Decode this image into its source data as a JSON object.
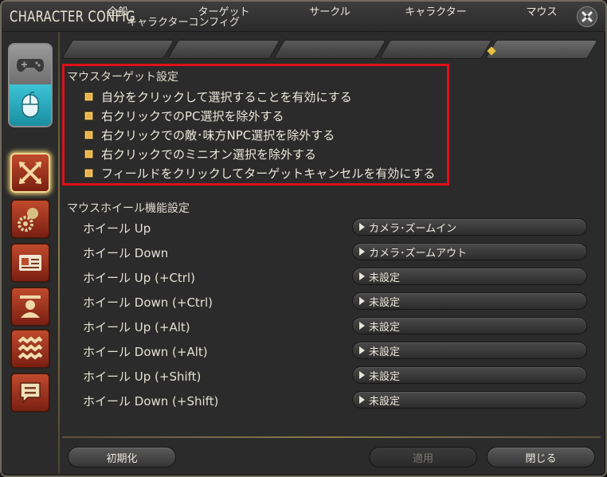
{
  "window": {
    "title": "CHARACTER CONFIG",
    "subtitle": "キャラクターコンフィグ"
  },
  "tabs": [
    {
      "label": "全般",
      "active": false
    },
    {
      "label": "ターゲット",
      "active": false
    },
    {
      "label": "サークル",
      "active": false
    },
    {
      "label": "キャラクター",
      "active": false
    },
    {
      "label": "マウス",
      "active": true
    }
  ],
  "mouse_target": {
    "title": "マウスターゲット設定",
    "options": [
      {
        "label": "自分をクリックして選択することを有効にする",
        "checked": true
      },
      {
        "label": "右クリックでのPC選択を除外する",
        "checked": true
      },
      {
        "label": "右クリックでの敵･味方NPC選択を除外する",
        "checked": true
      },
      {
        "label": "右クリックでのミニオン選択を除外する",
        "checked": true
      },
      {
        "label": "フィールドをクリックしてターゲットキャンセルを有効にする",
        "checked": true
      }
    ]
  },
  "mouse_wheel": {
    "title": "マウスホイール機能設定",
    "rows": [
      {
        "label": "ホイール Up",
        "value": "カメラ･ズームイン"
      },
      {
        "label": "ホイール Down",
        "value": "カメラ･ズームアウト"
      },
      {
        "label": "ホイール Up (+Ctrl)",
        "value": "未設定"
      },
      {
        "label": "ホイール Down (+Ctrl)",
        "value": "未設定"
      },
      {
        "label": "ホイール Up (+Alt)",
        "value": "未設定"
      },
      {
        "label": "ホイール Down (+Alt)",
        "value": "未設定"
      },
      {
        "label": "ホイール Up (+Shift)",
        "value": "未設定"
      },
      {
        "label": "ホイール Down (+Shift)",
        "value": "未設定"
      }
    ]
  },
  "footer": {
    "reset_label": "初期化",
    "apply_label": "適用",
    "close_label": "閉じる"
  },
  "colors": {
    "highlight_border": "#e0101a",
    "checkbox": "#e6b24a",
    "category_button": "#a03820",
    "mouse_device": "#2aaec0"
  }
}
